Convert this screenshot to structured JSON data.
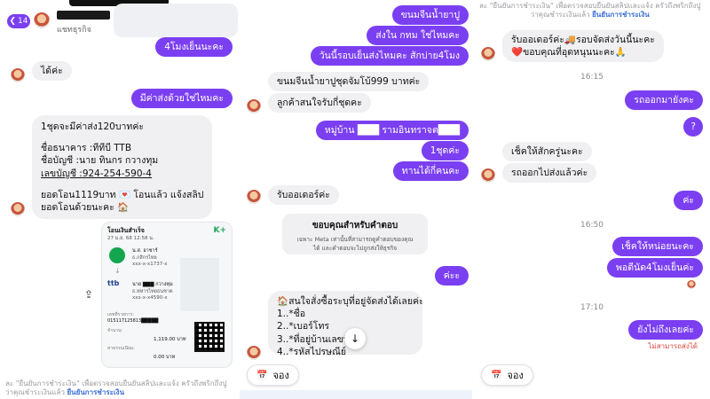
{
  "panel1": {
    "header": {
      "badge_count": "14",
      "subtitle": "แชทธุรกิจ"
    },
    "messages": {
      "out1": "4โมงเย็นนะคะ",
      "in1": "ได้ค่ะ",
      "out2": "มีค่าส่งด้วยใช่ไหมคะ",
      "in2": "1ชุดจะมีค่าส่ง120บาทค่ะ",
      "bank_lines": [
        "ชื่อธนาคาร :ทีทีบี TTB",
        "ชื่อบัญชี  :นาย ทินกร กวางทุม",
        "เลขบัญชี :924-254-590-4",
        "",
        "ยอดโอน1119บาท 💌 โอนแล้ว แจ้งสลิป",
        "ยอดโอนด้วยนะคะ 🏠"
      ]
    },
    "slip": {
      "title": "โอนเงินสำเร็จ",
      "date": "27 ม.ย. 68  12:58 น.",
      "brand": "K+",
      "from_name": "น.ส. อาชาร์",
      "from_bank": "ธ.กสิกรไทย",
      "from_acct": "xxx-x-x1737-x",
      "to_name": "นาย ▇▇▇ กวางทุม",
      "to_bank": "ธ.ทหารไทยธนชาต",
      "to_acct": "xxx-x-x4590-x",
      "ref_label": "เลขที่รายการ:",
      "ref_value": "015117125813█████",
      "amount_label": "จำนวน:",
      "amount_value": "1,119.00 บาท",
      "fee_label": "ค่าธรรมเนียม:",
      "fee_value": "0.00 บาท"
    },
    "footer": {
      "line1_pre": "ละ \"ยืนยันการชำระเงิน\" เพื่อตรวจสอบยืนยันสลิปและแจ้ง ครัวถึงพริกถึงปู",
      "line2_pre": "ว่าคุณชำระเงินแล้ว",
      "line2_link": "ยืนยันการชำระเงิน"
    }
  },
  "panel2": {
    "messages": {
      "out1": "ขนมจีนน้ำยาปู",
      "out2": "ส่งใน กทม ใช่ไหมคะ",
      "out3": "วันนี้รอบเย็นส่งไหมคะ สักบ่าย4โมง",
      "in1": "ขนมจีนน้ำยาปูชุดจัมโบ้999 บาทค่ะ",
      "in2": "ลูกค้าสนใจรับกี่ชุดคะ",
      "out4": "หมู่บ้าน ███ รามอินทราจต███",
      "out5": "1ชุดค่ะ",
      "out6": "ทานได้กี่คนคะ",
      "in3": "รับออเดอร์ค่ะ",
      "system_title": "ขอบคุณสำหรับคำตอบ",
      "system_body1": "เฉพาะ Meta เท่านั้นที่สามารถดูคำตอบของคุณ",
      "system_body2": "ได้ และคำตอบจะไม่ถูกส่งให้ธุรกิจ",
      "out7": "ค่ะะ",
      "form_lines": [
        "🏠สนใจสั่งซื้อระบุที่อยู่จัดส่งได้เลยค่ะ",
        "1..*ชื่อ",
        "2..*เบอร์โทร",
        "3..*ที่อยู่บ้านเลขที่",
        "4..*รหัสไปรษณีย์"
      ]
    },
    "book_chip": "จอง"
  },
  "panel3": {
    "header_note_line1": "ละ \"ยืนยันการชำระเงิน\" เพื่อตรวจสอบยืนยันสลิปและแจ้ง ครัวถึงพริกถึงปู",
    "header_note_line2_pre": "ว่าคุณชำระเงินแล้ว",
    "header_note_link": "ยืนยันการชำระเงิน",
    "messages": {
      "in1_line1": "รับออเดอร์ค่ะ🚚รอบจัดส่งวันนี้นะคะ",
      "in1_line2": "❤️ขอบคุณที่อุดหนุนนะคะ🙏",
      "time1": "16:15",
      "out1": "รถออกมายังคะ",
      "out2": "?",
      "in2": "เช็คให้สักครู่นะคะ",
      "in3": "รถออกไปส่งแล้วค่ะ",
      "out3": "ค่ะ",
      "time2": "16:50",
      "out4": "เช็คให้หน่อยนะคะ",
      "out5": "พอดีนัด4โมงเย็นค่ะ",
      "time3": "17:10",
      "out6": "ยังไม่ถึงเลยค่ะ",
      "error": "ไม่สามารถส่งได้"
    },
    "book_chip": "จอง"
  },
  "colors": {
    "accent": "#7b3ff2",
    "bubble_in": "#f0f0f2",
    "link": "#3b6fd6",
    "error": "#e0433a"
  }
}
